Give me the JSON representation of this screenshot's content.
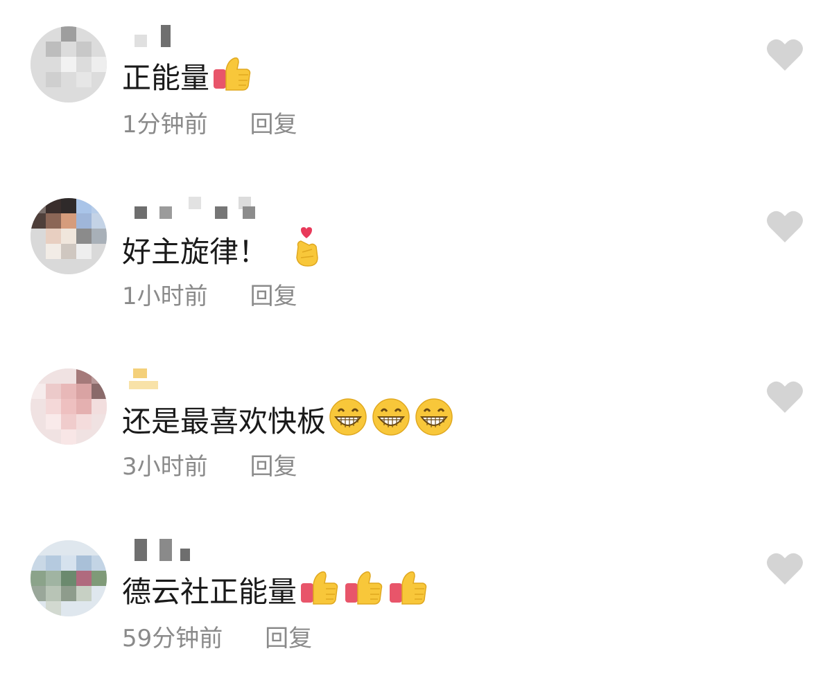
{
  "comments": [
    {
      "text": "正能量",
      "time": "1分钟前",
      "reply_label": "回复",
      "emojis": [
        "thumbs-up"
      ]
    },
    {
      "text": "好主旋律！",
      "time": "1小时前",
      "reply_label": "回复",
      "emojis": [
        "finger-heart"
      ]
    },
    {
      "text": "还是最喜欢快板",
      "time": "3小时前",
      "reply_label": "回复",
      "emojis": [
        "grinning-face",
        "grinning-face",
        "grinning-face"
      ]
    },
    {
      "text": "德云社正能量",
      "time": "59分钟前",
      "reply_label": "回复",
      "emojis": [
        "thumbs-up",
        "thumbs-up",
        "thumbs-up"
      ]
    }
  ],
  "colors": {
    "text": "#1a1a1a",
    "meta": "#8a8a8a",
    "heart": "#d4d4d4",
    "thumb": "#f8c73a",
    "cuff": "#e8556a"
  }
}
